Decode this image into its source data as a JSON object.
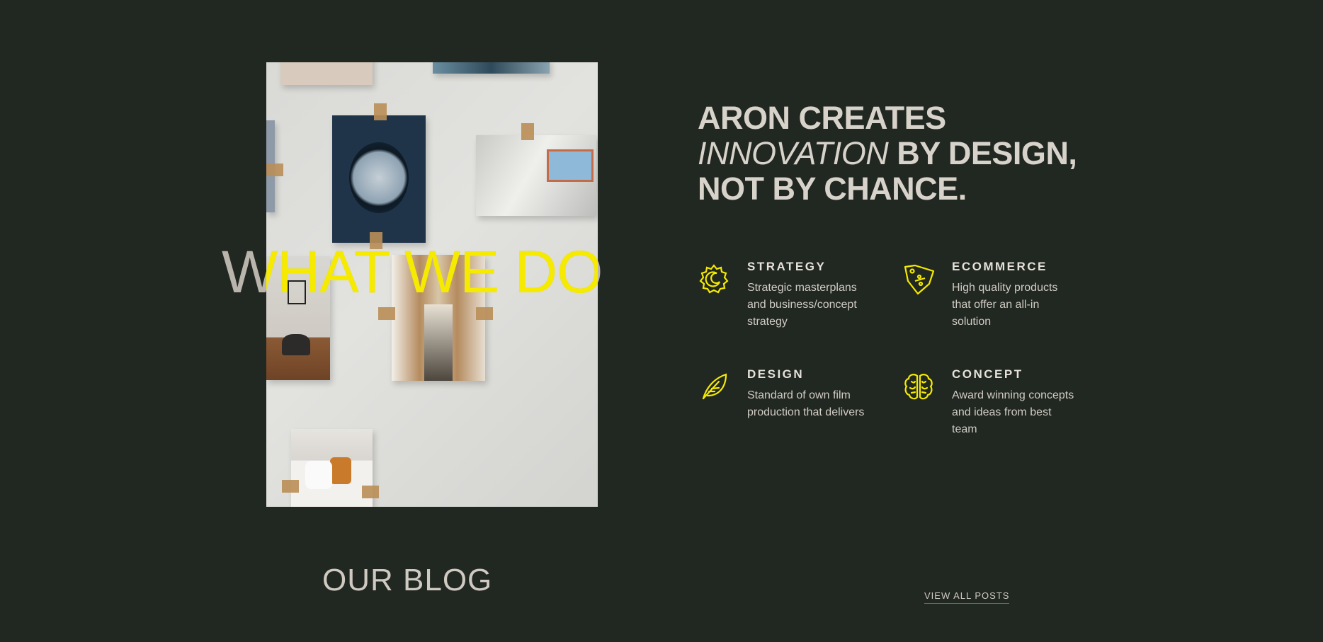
{
  "hero": {
    "section_title": "WHAT WE DO",
    "headline_line1": "ARON CREATES",
    "headline_italic": "INNOVATION",
    "headline_rest": " BY DESIGN,",
    "headline_line3": "NOT BY CHANCE."
  },
  "features": [
    {
      "icon": "sun-strategy-icon",
      "title": "STRATEGY",
      "description": "Strategic masterplans and business/concept strategy"
    },
    {
      "icon": "price-tag-icon",
      "title": "ECOMMERCE",
      "description": "High quality products that offer an all-in solution"
    },
    {
      "icon": "leaf-icon",
      "title": "DESIGN",
      "description": "Standard of own film production that delivers"
    },
    {
      "icon": "brain-icon",
      "title": "CONCEPT",
      "description": "Award winning concepts and ideas from best team"
    }
  ],
  "blog": {
    "title": "OUR BLOG",
    "view_all_label": "VIEW ALL POSTS"
  },
  "colors": {
    "background": "#212721",
    "accent": "#f5ea00",
    "text": "#d8d3ca"
  }
}
